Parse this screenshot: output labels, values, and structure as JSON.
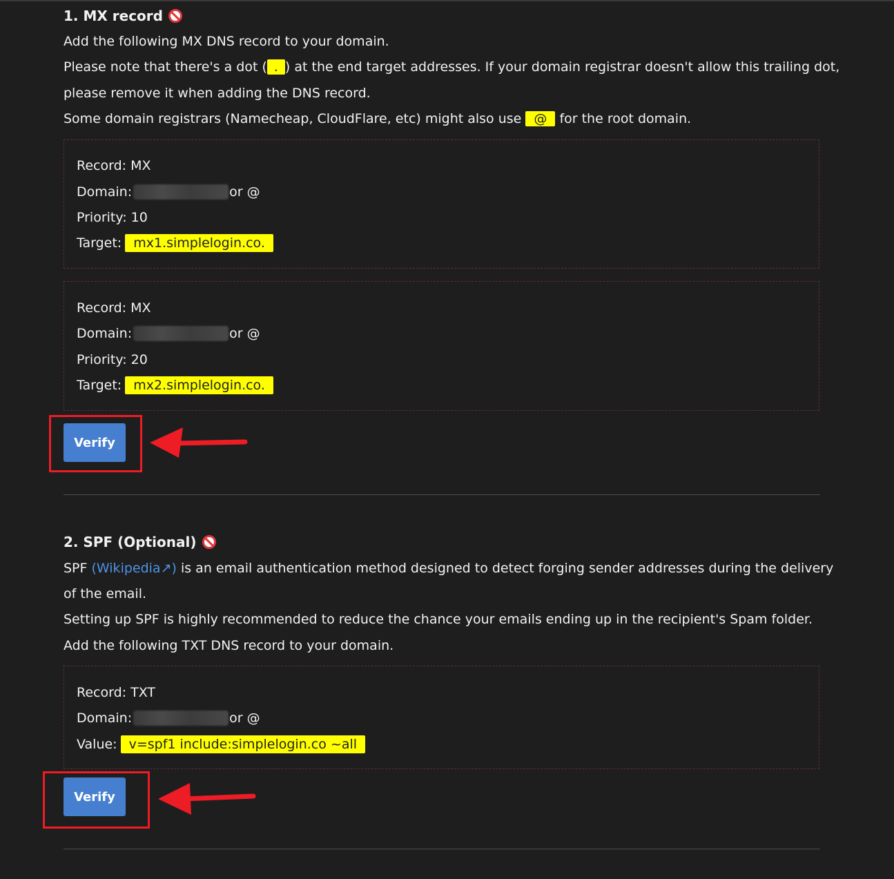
{
  "mx": {
    "title": "1. MX record",
    "status_icon": "prohibited-icon",
    "desc1": "Add the following MX DNS record to your domain.",
    "desc2_pre": "Please note that there's a dot (",
    "dot": ".",
    "desc2_post": ") at the end target addresses. If your domain registrar doesn't allow this trailing dot,",
    "desc3": "please remove it when adding the DNS record.",
    "desc4_pre": "Some domain registrars (Namecheap, CloudFlare, etc) might also use",
    "at": "@",
    "desc4_post": "for the root domain.",
    "records": [
      {
        "record": "Record: MX",
        "domain_label": "Domain:",
        "domain_suffix": "or @",
        "priority": "Priority: 10",
        "target_label": "Target:",
        "target": "mx1.simplelogin.co."
      },
      {
        "record": "Record: MX",
        "domain_label": "Domain:",
        "domain_suffix": "or @",
        "priority": "Priority: 20",
        "target_label": "Target:",
        "target": "mx2.simplelogin.co."
      }
    ],
    "verify_label": "Verify"
  },
  "spf": {
    "title": "2. SPF (Optional)",
    "status_icon": "prohibited-icon",
    "desc1_pre": "SPF",
    "wiki_link": "(Wikipedia↗)",
    "desc1_post": "is an email authentication method designed to detect forging sender addresses during the delivery",
    "desc2": "of the email.",
    "desc3": "Setting up SPF is highly recommended to reduce the chance your emails ending up in the recipient's Spam folder.",
    "desc4": "Add the following TXT DNS record to your domain.",
    "record": {
      "record": "Record: TXT",
      "domain_label": "Domain:",
      "domain_suffix": "or @",
      "value_label": "Value:",
      "value": "v=spf1 include:simplelogin.co ~all"
    },
    "verify_label": "Verify"
  },
  "colors": {
    "highlight": "#ffff00",
    "annotation": "#ee1c25",
    "button": "#467fcf",
    "link": "#4e93e6"
  }
}
